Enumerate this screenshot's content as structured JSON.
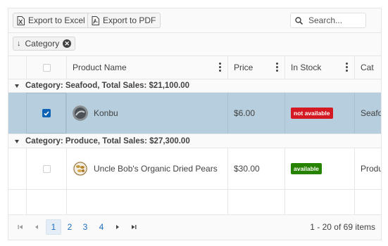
{
  "toolbar": {
    "export_excel_label": "Export to Excel",
    "export_pdf_label": "Export to PDF",
    "search_placeholder": "Search..."
  },
  "group_panel": {
    "chip_label": "Category"
  },
  "columns": {
    "product_name": "Product Name",
    "price": "Price",
    "in_stock": "In Stock",
    "category": "Cat"
  },
  "groups": [
    {
      "label": "Category: Seafood, Total Sales: $21,100.00",
      "rows": [
        {
          "product_name": "Konbu",
          "price": "$6.00",
          "in_stock": "not available",
          "category": "Seafo",
          "selected": true,
          "stock_color": "#d51923"
        }
      ]
    },
    {
      "label": "Category: Produce, Total Sales: $27,300.00",
      "rows": [
        {
          "product_name": "Uncle Bob's Organic Dried Pears",
          "price": "$30.00",
          "in_stock": "available",
          "category": "Produ",
          "selected": false,
          "stock_color": "#278200"
        }
      ]
    }
  ],
  "pager": {
    "pages": [
      "1",
      "2",
      "3",
      "4"
    ],
    "current_page": "1",
    "info": "1 - 20 of 69 items"
  },
  "colors": {
    "selection": "#b6cedd",
    "checkbox_checked": "#0f63b5",
    "link": "#1e6fbf",
    "not_available": "#d51923",
    "available": "#278200"
  }
}
